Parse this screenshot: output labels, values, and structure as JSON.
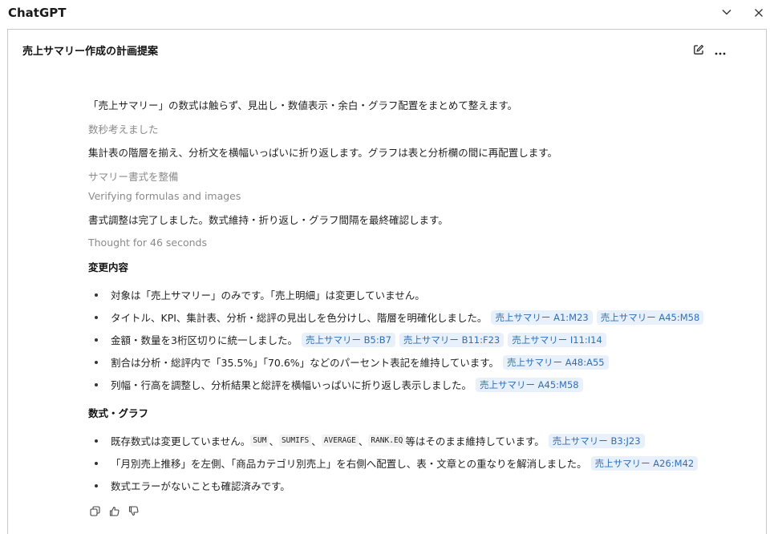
{
  "app": {
    "title": "ChatGPT"
  },
  "window": {
    "minimize_icon": "chevron-down-icon",
    "close_icon": "close-icon"
  },
  "panel": {
    "title": "売上サマリー作成の計画提案",
    "edit_icon": "edit-icon",
    "more_icon": "more-icon"
  },
  "messages": {
    "intro": "「売上サマリー」の数式は触らず、見出し・数値表示・余白・グラフ配置をまとめて整えます。",
    "thought1": "数秒考えました",
    "step1": "集計表の階層を揃え、分析文を横幅いっぱいに折り返します。グラフは表と分析欄の間に再配置します。",
    "thought2": "サマリー書式を整備",
    "thought3": "Verifying formulas and images",
    "step2": "書式調整は完了しました。数式維持・折り返し・グラフ間隔を最終確認します。",
    "thought4": "Thought for 46 seconds"
  },
  "changes": {
    "heading": "変更内容",
    "items": [
      {
        "text": "対象は「売上サマリー」のみです。「売上明細」は変更していません。",
        "chips": []
      },
      {
        "text": "タイトル、KPI、集計表、分析・総評の見出しを色分けし、階層を明確化しました。",
        "chips": [
          "売上サマリー A1:M23",
          "売上サマリー A45:M58"
        ]
      },
      {
        "text": "金額・数量を3桁区切りに統一しました。",
        "chips": [
          "売上サマリー B5:B7",
          "売上サマリー B11:F23",
          "売上サマリー I11:I14"
        ]
      },
      {
        "text": "割合は分析・総評内で「35.5%」「70.6%」などのパーセント表記を維持しています。",
        "chips": [
          "売上サマリー A48:A55"
        ]
      },
      {
        "text": "列幅・行高を調整し、分析結果と総評を横幅いっぱいに折り返し表示しました。",
        "chips": [
          "売上サマリー A45:M58"
        ]
      }
    ]
  },
  "formulas": {
    "heading": "数式・グラフ",
    "item1": {
      "prefix": "既存数式は変更していません。",
      "codes": [
        "SUM",
        "SUMIFS",
        "AVERAGE",
        "RANK.EQ"
      ],
      "sep": "、",
      "suffix": "等はそのまま維持しています。",
      "chip": "売上サマリー B3:J23"
    },
    "item2": {
      "text": "「月別売上推移」を左側、「商品カテゴリ別売上」を右側へ配置し、表・文章との重なりを解消しました。",
      "chip": "売上サマリー A26:M42"
    },
    "item3": {
      "text": "数式エラーがないことも確認済みです。"
    }
  },
  "feedback": {
    "copy_icon": "copy-icon",
    "like_icon": "thumbs-up-icon",
    "dislike_icon": "thumbs-down-icon"
  }
}
